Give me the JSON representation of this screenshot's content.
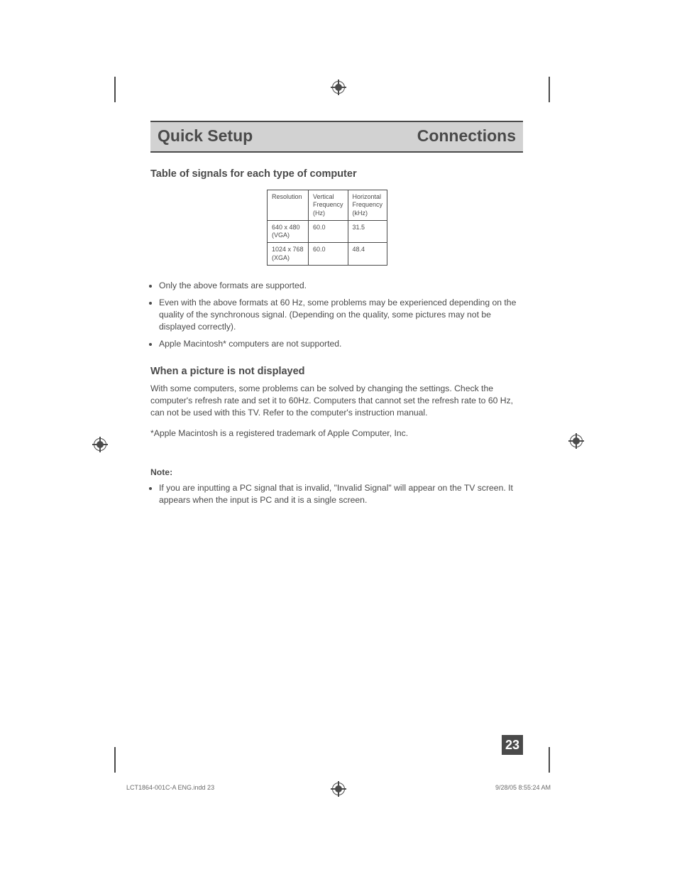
{
  "header": {
    "left": "Quick Setup",
    "right": "Connections"
  },
  "section1": {
    "title": "Table of signals for each type of computer",
    "table": {
      "headers": {
        "resolution": "Resolution",
        "vfreq": "Vertical Frequency (Hz)",
        "hfreq": "Horizontal Frequency (kHz)"
      },
      "rows": [
        {
          "resolution": "640 x 480 (VGA)",
          "vfreq": "60.0",
          "hfreq": "31.5"
        },
        {
          "resolution": "1024 x 768 (XGA)",
          "vfreq": "60.0",
          "hfreq": "48.4"
        }
      ]
    },
    "bullets": [
      "Only the above formats are supported.",
      "Even with the above formats at 60 Hz, some problems may be experienced depending on the quality of the synchronous signal.  (Depending on the quality, some pictures may not be displayed correctly).",
      "Apple Macintosh* computers are not supported."
    ]
  },
  "section2": {
    "title": "When a picture is not displayed",
    "para1": "With some computers, some problems can be solved by changing the settings.  Check the computer's refresh rate and set it to 60Hz.  Computers that cannot set the refresh rate to 60 Hz, can not be used with this TV.  Refer to the computer's instruction manual.",
    "para2": "*Apple Macintosh is a registered trademark of Apple Computer, Inc."
  },
  "note": {
    "label": "Note:",
    "bullets": [
      "If you are inputting a PC signal that is invalid, \"Invalid Signal\" will appear on the TV screen.  It appears when the input is PC and it is a single screen."
    ]
  },
  "page_number": "23",
  "footer": {
    "left": "LCT1864-001C-A ENG.indd   23",
    "right": "9/28/05   8:55:24 AM"
  }
}
